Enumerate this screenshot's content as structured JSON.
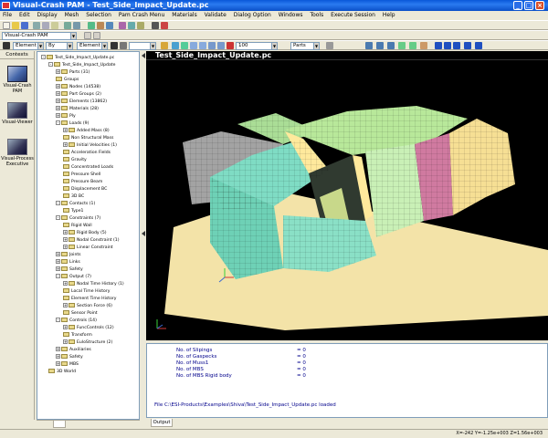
{
  "window": {
    "title": "Visual-Crash PAM - Test_Side_Impact_Update.pc",
    "minimize": "_",
    "maximize": "□",
    "close": "×"
  },
  "menu": [
    "File",
    "Edit",
    "Display",
    "Mesh",
    "Selection",
    "Pam Crash Menu",
    "Materials",
    "Validate",
    "Dialog Option",
    "Windows",
    "Tools",
    "Execute Session",
    "Help"
  ],
  "toolbar": {
    "context_combo": "Visual-Crash PAM",
    "element_combo1": "Element",
    "by_combo": "By",
    "element_combo2": "Element",
    "zoom_value": "100",
    "parts_combo": "Parts"
  },
  "contexts": {
    "header": "Contexts",
    "items": [
      {
        "label1": "Visual-Crash",
        "label2": "PAM"
      },
      {
        "label1": "Visual-Viewer",
        "label2": ""
      },
      {
        "label1": "Visual-Process",
        "label2": "Executive"
      }
    ]
  },
  "tree": [
    {
      "d": 0,
      "s": "-",
      "label": "Test_Side_Impact_Update.pc"
    },
    {
      "d": 1,
      "s": "-",
      "label": "Test_Side_Impact_Update"
    },
    {
      "d": 2,
      "s": "+",
      "label": "Parts (31)"
    },
    {
      "d": 2,
      "s": "",
      "label": "Groups"
    },
    {
      "d": 2,
      "s": "+",
      "label": "Nodes (14538)"
    },
    {
      "d": 2,
      "s": "+",
      "label": "Part Groups (2)"
    },
    {
      "d": 2,
      "s": "+",
      "label": "Elements (13862)"
    },
    {
      "d": 2,
      "s": "+",
      "label": "Materials (28)"
    },
    {
      "d": 2,
      "s": "+",
      "label": "Ply"
    },
    {
      "d": 2,
      "s": "-",
      "label": "Loads (9)"
    },
    {
      "d": 3,
      "s": "+",
      "label": "Added Mass (8)"
    },
    {
      "d": 3,
      "s": "",
      "label": "Non Structural Mass"
    },
    {
      "d": 3,
      "s": "+",
      "label": "Initial Velocities (1)"
    },
    {
      "d": 3,
      "s": "",
      "label": "Acceleration Fields"
    },
    {
      "d": 3,
      "s": "",
      "label": "Gravity"
    },
    {
      "d": 3,
      "s": "",
      "label": "Concentrated Loads"
    },
    {
      "d": 3,
      "s": "",
      "label": "Pressure Shell"
    },
    {
      "d": 3,
      "s": "",
      "label": "Pressure Beam"
    },
    {
      "d": 3,
      "s": "",
      "label": "Displacement BC"
    },
    {
      "d": 3,
      "s": "",
      "label": "3D BC"
    },
    {
      "d": 2,
      "s": "-",
      "label": "Contacts (1)"
    },
    {
      "d": 3,
      "s": "",
      "label": "Type1"
    },
    {
      "d": 2,
      "s": "-",
      "label": "Constraints (7)"
    },
    {
      "d": 3,
      "s": "",
      "label": "Rigid Wall"
    },
    {
      "d": 3,
      "s": "+",
      "label": "Rigid Body (5)"
    },
    {
      "d": 3,
      "s": "+",
      "label": "Nodal Constraint (1)"
    },
    {
      "d": 3,
      "s": "+",
      "label": "Linear Constraint"
    },
    {
      "d": 2,
      "s": "+",
      "label": "Joints"
    },
    {
      "d": 2,
      "s": "+",
      "label": "Links"
    },
    {
      "d": 2,
      "s": "+",
      "label": "Safety"
    },
    {
      "d": 2,
      "s": "-",
      "label": "Output (7)"
    },
    {
      "d": 3,
      "s": "+",
      "label": "Nodal Time History (1)"
    },
    {
      "d": 3,
      "s": "",
      "label": "Local Time History"
    },
    {
      "d": 3,
      "s": "",
      "label": "Element Time History"
    },
    {
      "d": 3,
      "s": "+",
      "label": "Section Force (6)"
    },
    {
      "d": 3,
      "s": "",
      "label": "Sensor Point"
    },
    {
      "d": 2,
      "s": "-",
      "label": "Controls (14)"
    },
    {
      "d": 3,
      "s": "+",
      "label": "FuncControls (12)"
    },
    {
      "d": 3,
      "s": "",
      "label": "Transform"
    },
    {
      "d": 3,
      "s": "+",
      "label": "EuloStructure (2)"
    },
    {
      "d": 2,
      "s": "+",
      "label": "Auxiliaries"
    },
    {
      "d": 2,
      "s": "+",
      "label": "Safety"
    },
    {
      "d": 2,
      "s": "+",
      "label": "MBS"
    },
    {
      "d": 1,
      "s": "",
      "label": "3D World"
    }
  ],
  "view": {
    "title": "Test_Side_Impact_Update.pc"
  },
  "output": {
    "lines": [
      {
        "label": "No. of Slipings",
        "value": "= 0"
      },
      {
        "label": "No. of Gaspecks",
        "value": "= 0"
      },
      {
        "label": "No. of Muss1",
        "value": "= 0"
      },
      {
        "label": "No. of MBS",
        "value": "= 0"
      },
      {
        "label": "No. of MBS Rigid body",
        "value": "= 0"
      }
    ],
    "file_line": "File C:\\ESI-Products\\Examples\\Shiva\\Test_Side_Impact_Update.pc loaded",
    "tab": "Output"
  },
  "status": {
    "coords": "X=-242   Y=-1.25e+003   Z=1.56e+003"
  }
}
